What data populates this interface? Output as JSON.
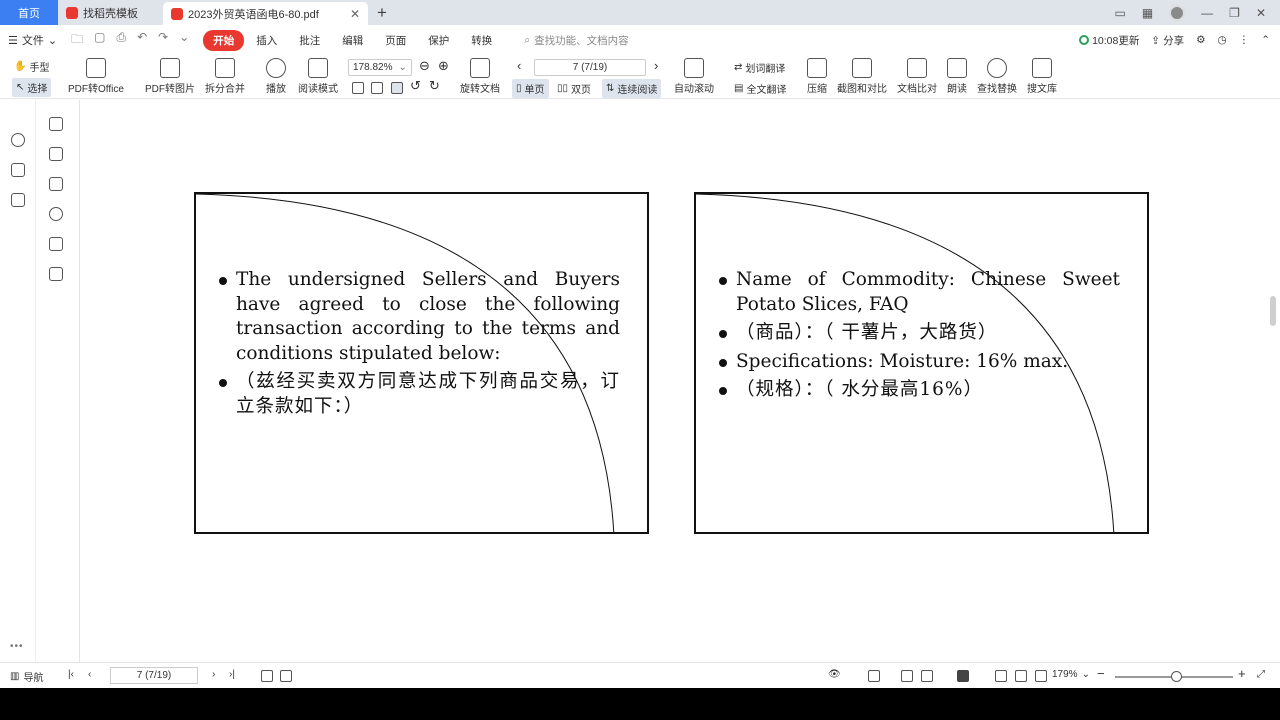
{
  "tabs": {
    "home": "首页",
    "template": "找稻壳模板",
    "document": "2023外贸英语函电6-80.pdf",
    "add": "+"
  },
  "menu": {
    "file": "文件",
    "tabs": [
      "开始",
      "插入",
      "批注",
      "编辑",
      "页面",
      "保护",
      "转换"
    ],
    "active_tab": "开始",
    "search_placeholder": "查找功能、文档内容",
    "sync_status": "10:08更新",
    "share": "分享"
  },
  "toolbar": {
    "hand": "手型",
    "select": "选择",
    "pdf_to_office": "PDF转Office",
    "pdf_to_image": "PDF转图片",
    "split_merge": "拆分合并",
    "play": "播放",
    "read_mode": "阅读模式",
    "zoom": "178.82%",
    "page_input": "7 (7/19)",
    "rotate_doc": "旋转文档",
    "single_page": "单页",
    "double_page": "双页",
    "continuous": "连续阅读",
    "auto_scroll": "自动滚动",
    "word_translate": "划词翻译",
    "full_translate": "全文翻译",
    "compress": "压缩",
    "screenshot_compare": "截图和对比",
    "doc_compare": "文档比对",
    "read_aloud": "朗读",
    "find_replace": "查找替换",
    "search_library": "搜文库"
  },
  "slides": [
    {
      "bullets": [
        "The undersigned Sellers and Buyers have agreed to close the following transaction according to the terms and conditions stipulated below:",
        "（兹经买卖双方同意达成下列商品交易，订立条款如下：）"
      ]
    },
    {
      "bullets": [
        "Name of Commodity: Chinese Sweet Potato Slices, FAQ",
        "（商品）：（ 干薯片，大路货）",
        "Specifications: Moisture: 16% max.",
        "（规格）：（ 水分最高16%）"
      ]
    }
  ],
  "statusbar": {
    "nav": "导航",
    "page_input": "7 (7/19)",
    "zoom": "179%",
    "zoom_out": "−",
    "zoom_in": "+"
  },
  "sidebar": {
    "more": "•••"
  }
}
